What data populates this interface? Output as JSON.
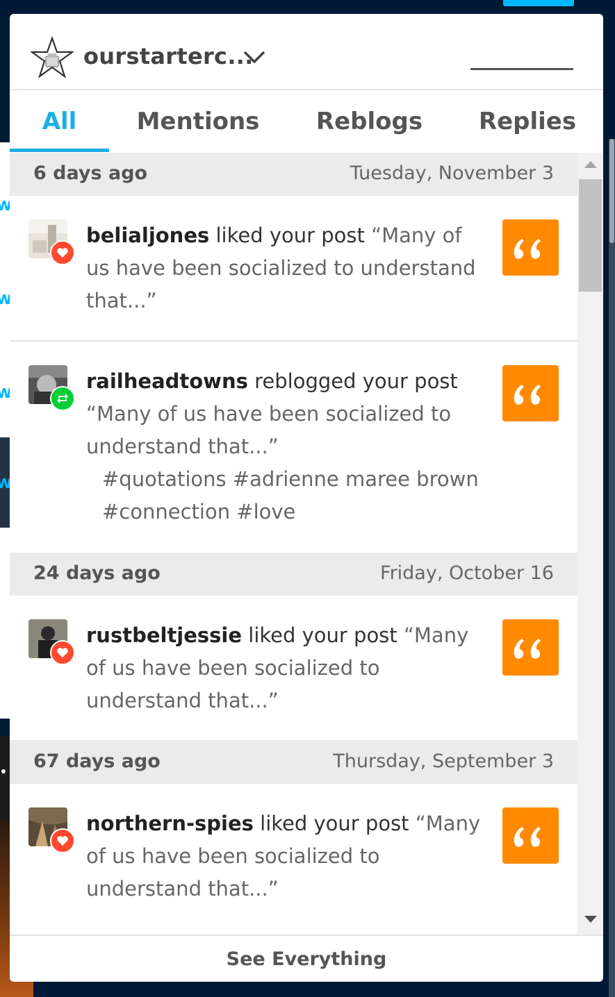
{
  "blog": {
    "name": "ourstarterc...",
    "avatar_icon": "star-outline-icon"
  },
  "tabs": [
    {
      "label": "All",
      "active": true
    },
    {
      "label": "Mentions",
      "active": false
    },
    {
      "label": "Reblogs",
      "active": false
    },
    {
      "label": "Replies",
      "active": false
    }
  ],
  "groups": [
    {
      "ago": "6 days ago",
      "date": "Tuesday, November 3",
      "items": [
        {
          "user": "belialjones",
          "action": "liked your post",
          "quote": "“Many of us have been socialized to understand that...”",
          "tags": "",
          "badge": "heart-icon"
        },
        {
          "user": "railheadtowns",
          "action": "reblogged your post",
          "quote": "“Many of us have been socialized to understand that...”",
          "tags": "#quotations #adrienne maree brown #connection #love",
          "badge": "reblog-icon"
        }
      ]
    },
    {
      "ago": "24 days ago",
      "date": "Friday, October 16",
      "items": [
        {
          "user": "rustbeltjessie",
          "action": "liked your post",
          "quote": "“Many of us have been socialized to understand that...”",
          "tags": "",
          "badge": "heart-icon"
        }
      ]
    },
    {
      "ago": "67 days ago",
      "date": "Thursday, September 3",
      "items": [
        {
          "user": "northern-spies",
          "action": "liked your post",
          "quote": "“Many of us have been socialized to understand that...”",
          "tags": "",
          "badge": "heart-icon"
        }
      ]
    }
  ],
  "footer": {
    "label": "See Everything"
  },
  "colors": {
    "accent": "#1eaee6",
    "quote_post": "#ff8a00",
    "like": "#ff4930",
    "reblog": "#00cf35"
  }
}
